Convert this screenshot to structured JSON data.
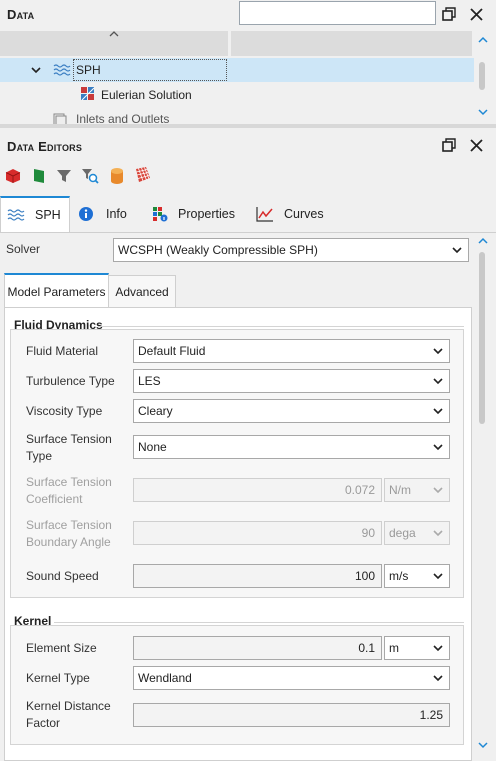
{
  "data_panel": {
    "title": "Data",
    "search_placeholder": "",
    "tree": {
      "sph_label": "SPH",
      "eulerian_label": "Eulerian Solution",
      "inlets_label": "Inlets and Outlets"
    }
  },
  "editors_panel": {
    "title": "Data Editors",
    "toolbar_icons": [
      "red-cube-icon",
      "green-flag-icon",
      "filter-icon",
      "search-filter-icon",
      "cylinder-icon",
      "surface-mesh-icon"
    ]
  },
  "tabs": [
    {
      "label": "SPH",
      "icon": "waves-icon",
      "active": true
    },
    {
      "label": "Info",
      "icon": "info-icon",
      "active": false
    },
    {
      "label": "Properties",
      "icon": "properties-icon",
      "active": false
    },
    {
      "label": "Curves",
      "icon": "curves-icon",
      "active": false
    }
  ],
  "solver": {
    "label": "Solver",
    "value": "WCSPH (Weakly Compressible SPH)"
  },
  "subtabs": [
    {
      "label": "Model Parameters",
      "active": true
    },
    {
      "label": "Advanced",
      "active": false
    }
  ],
  "fluid_dynamics": {
    "title": "Fluid Dynamics",
    "fluid_material": {
      "label": "Fluid Material",
      "value": "Default Fluid"
    },
    "turbulence_type": {
      "label": "Turbulence Type",
      "value": "LES"
    },
    "viscosity_type": {
      "label": "Viscosity Type",
      "value": "Cleary"
    },
    "surface_tension_type": {
      "label1": "Surface Tension",
      "label2": "Type",
      "value": "None"
    },
    "surface_tension_coeff": {
      "label1": "Surface Tension",
      "label2": "Coefficient",
      "value": "0.072",
      "unit": "N/m"
    },
    "surface_tension_angle": {
      "label1": "Surface Tension",
      "label2": "Boundary Angle",
      "value": "90",
      "unit": "dega"
    },
    "sound_speed": {
      "label": "Sound Speed",
      "value": "100",
      "unit": "m/s"
    }
  },
  "kernel": {
    "title": "Kernel",
    "element_size": {
      "label": "Element Size",
      "value": "0.1",
      "unit": "m"
    },
    "kernel_type": {
      "label": "Kernel Type",
      "value": "Wendland"
    },
    "kernel_distance": {
      "label1": "Kernel Distance",
      "label2": "Factor",
      "value": "1.25"
    }
  },
  "colors": {
    "selection": "#cde6f7",
    "accent": "#1e88d4",
    "panel_bg": "#f0f0f0"
  }
}
